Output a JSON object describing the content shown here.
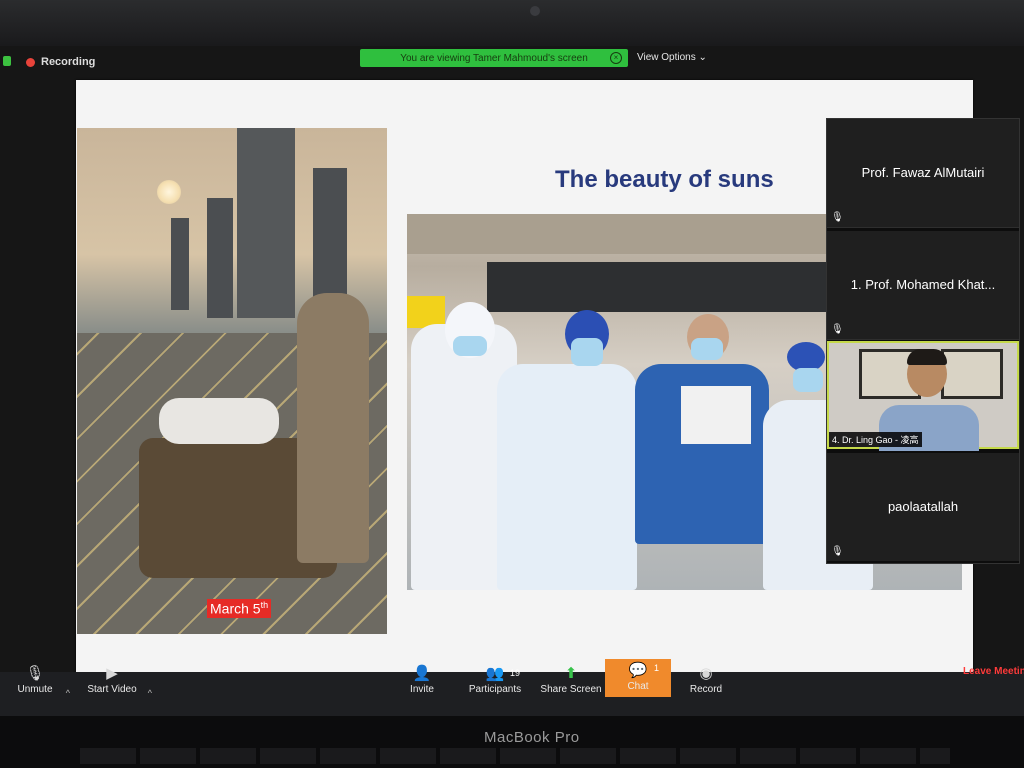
{
  "device": {
    "brand_label": "MacBook Pro"
  },
  "topbar": {
    "recording_label": "Recording",
    "viewing_banner": "You are viewing Tamer Mahmoud's screen",
    "view_options": "View Options"
  },
  "slide": {
    "title": "The beauty of suns",
    "date_badge_main": "March 5",
    "date_badge_sup": "th"
  },
  "gallery": {
    "participants": [
      {
        "name": "Prof. Fawaz AlMutairi",
        "video": false,
        "muted": true
      },
      {
        "name": "1. Prof. Mohamed Khat...",
        "video": false,
        "muted": true
      },
      {
        "name": "4. Dr. Ling Gao - 凌高",
        "video": true,
        "muted": false
      },
      {
        "name": "paolaatallah",
        "video": false,
        "muted": true
      }
    ]
  },
  "toolbar": {
    "unmute": "Unmute",
    "start_video": "Start Video",
    "invite": "Invite",
    "participants": "Participants",
    "participants_count": "19",
    "share_screen": "Share Screen",
    "chat": "Chat",
    "chat_count": "1",
    "record": "Record",
    "leave": "Leave Meeting"
  },
  "colors": {
    "accent_green": "#2fbf3e",
    "chat_orange": "#f08a2c",
    "leave_red": "#ff3b3b",
    "title_blue": "#283a7d",
    "active_speaker_border": "#c5d94a"
  },
  "icons": [
    "lock-icon",
    "record-dot-icon",
    "close-icon",
    "mic-muted-icon",
    "video-off-icon",
    "invite-icon",
    "participants-icon",
    "share-screen-icon",
    "chat-icon",
    "record-icon",
    "chevron-up-icon",
    "chevron-down-icon"
  ]
}
